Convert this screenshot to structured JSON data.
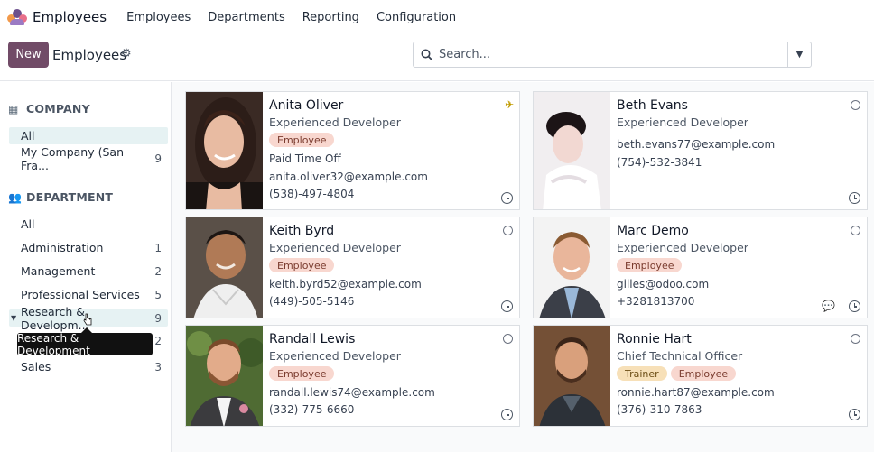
{
  "app": {
    "name": "Employees"
  },
  "menu": [
    {
      "label": "Employees"
    },
    {
      "label": "Departments"
    },
    {
      "label": "Reporting"
    },
    {
      "label": "Configuration"
    }
  ],
  "control": {
    "new_label": "New",
    "breadcrumb": "Employees",
    "search_placeholder": "Search..."
  },
  "sidebar": {
    "company_header": "COMPANY",
    "company_items": [
      {
        "label": "All",
        "count": ""
      },
      {
        "label": "My Company (San Fra...",
        "count": "9"
      }
    ],
    "department_header": "DEPARTMENT",
    "department_items": [
      {
        "label": "All",
        "count": ""
      },
      {
        "label": "Administration",
        "count": "1"
      },
      {
        "label": "Management",
        "count": "2"
      },
      {
        "label": "Professional Services",
        "count": "5"
      },
      {
        "label": "Research & Developm...",
        "count": "9"
      },
      {
        "label": "",
        "count": "2"
      },
      {
        "label": "Sales",
        "count": "3"
      }
    ],
    "tooltip": "Research & Development"
  },
  "employees": [
    {
      "name": "Anita Oliver",
      "job": "Experienced Developer",
      "tags": [
        "Employee"
      ],
      "extra": "Paid Time Off",
      "email": "anita.oliver32@example.com",
      "phone": "(538)-497-4804",
      "status": "away"
    },
    {
      "name": "Beth Evans",
      "job": "Experienced Developer",
      "tags": [],
      "extra": "",
      "email": "beth.evans77@example.com",
      "phone": "(754)-532-3841",
      "status": "offline"
    },
    {
      "name": "Keith Byrd",
      "job": "Experienced Developer",
      "tags": [
        "Employee"
      ],
      "extra": "",
      "email": "keith.byrd52@example.com",
      "phone": "(449)-505-5146",
      "status": "offline"
    },
    {
      "name": "Marc Demo",
      "job": "Experienced Developer",
      "tags": [
        "Employee"
      ],
      "extra": "",
      "email": "gilles@odoo.com",
      "phone": "+3281813700",
      "status": "offline"
    },
    {
      "name": "Randall Lewis",
      "job": "Experienced Developer",
      "tags": [
        "Employee"
      ],
      "extra": "",
      "email": "randall.lewis74@example.com",
      "phone": "(332)-775-6660",
      "status": "offline"
    },
    {
      "name": "Ronnie Hart",
      "job": "Chief Technical Officer",
      "tags": [
        "Trainer",
        "Employee"
      ],
      "extra": "",
      "email": "ronnie.hart87@example.com",
      "phone": "(376)-310-7863",
      "status": "offline"
    }
  ],
  "colors": {
    "accent": "#714B67",
    "active_bg": "#e6f2f3",
    "tag_employee": "#f8d7cf",
    "tag_trainer": "#f7e0b8"
  }
}
